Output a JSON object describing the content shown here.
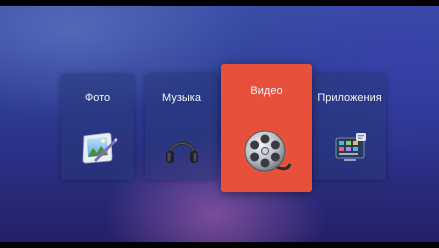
{
  "menu": {
    "items": [
      {
        "label": "Фото",
        "icon": "photo-icon"
      },
      {
        "label": "Музыка",
        "icon": "headphones-icon"
      },
      {
        "label": "Видео",
        "icon": "film-reel-icon"
      },
      {
        "label": "Приложения",
        "icon": "apps-icon"
      }
    ],
    "selected": "Видео"
  },
  "colors": {
    "accent": "#e7513b",
    "tile_background": "#28377a",
    "text": "#f2f4ff"
  }
}
